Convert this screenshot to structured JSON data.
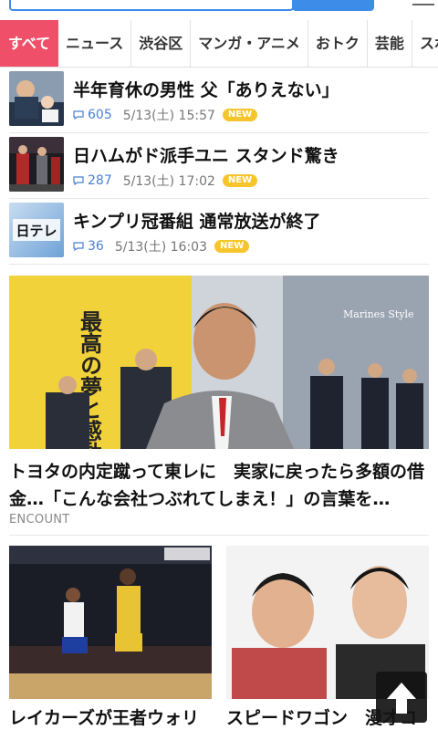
{
  "tabs": [
    {
      "label": "すべて",
      "active": true
    },
    {
      "label": "ニュース"
    },
    {
      "label": "渋谷区"
    },
    {
      "label": "マンガ・アニメ"
    },
    {
      "label": "おトク"
    },
    {
      "label": "芸能"
    },
    {
      "label": "スポ"
    }
  ],
  "news": [
    {
      "headline": "半年育休の男性 父「ありえない」",
      "comments": "605",
      "date": "5/13(土) 15:57",
      "badge": "NEW"
    },
    {
      "headline": "日ハムがド派手ユニ スタンド驚き",
      "comments": "287",
      "date": "5/13(土) 17:02",
      "badge": "NEW"
    },
    {
      "headline": "キンプリ冠番組 通常放送が終了",
      "comments": "36",
      "date": "5/13(土) 16:03",
      "badge": "NEW"
    }
  ],
  "thumb3_logo": "日テレ",
  "feature": {
    "title": "トヨタの内定蹴って東レに　実家に戻ったら多額の借金…「こんな会社つぶれてしまえ！」の言葉を…",
    "source": "ENCOUNT",
    "poster_text": "最高の夢と感動を分かち合う。",
    "banner_text": "Marines Style"
  },
  "cards": [
    {
      "title": "レイカーズが王者ウォリ"
    },
    {
      "title": "スピードワゴン　漫才コ"
    }
  ],
  "colors": {
    "accent": "#ef4f68",
    "search": "#3d8de8",
    "link": "#4a7fd0",
    "badge": "#f6c52d"
  }
}
